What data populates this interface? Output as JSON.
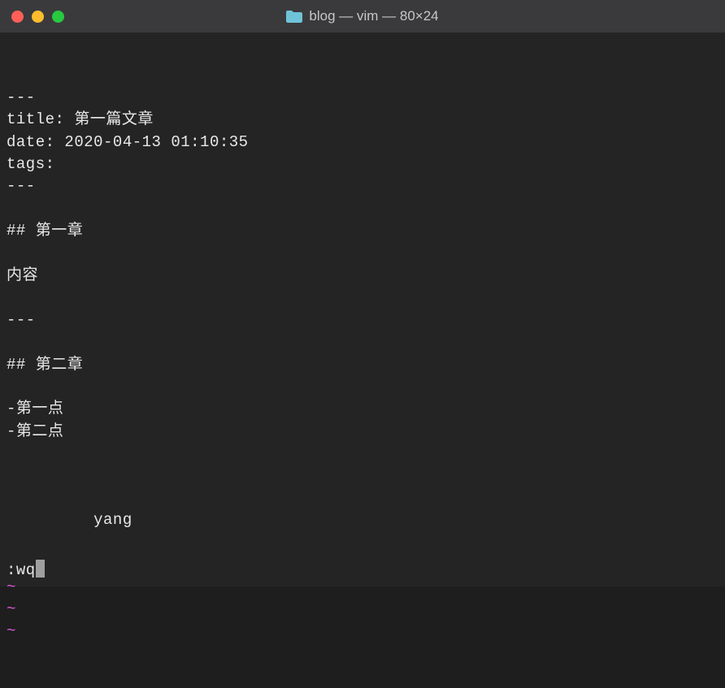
{
  "window": {
    "title": "blog — vim — 80×24"
  },
  "editor": {
    "lines": [
      "---",
      "title: 第一篇文章",
      "date: 2020-04-13 01:10:35",
      "tags:",
      "---",
      "",
      "## 第一章",
      "",
      "内容",
      "",
      "---",
      "",
      "## 第二章",
      "",
      "-第一点",
      "-第二点",
      "",
      "",
      "",
      "         yang"
    ],
    "tilde_rows": [
      "~",
      "~",
      "~"
    ],
    "command": ":wq"
  }
}
